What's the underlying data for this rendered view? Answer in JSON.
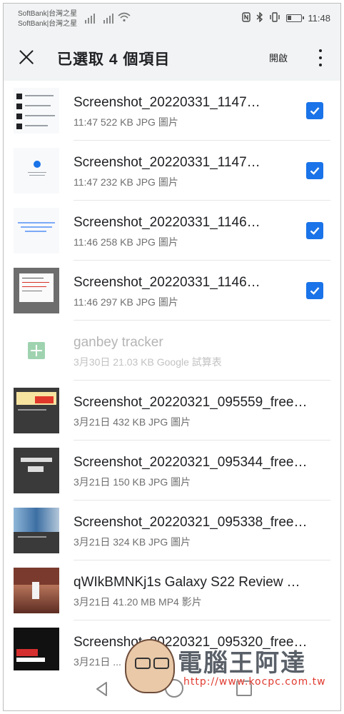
{
  "status_bar": {
    "carrier_1": "SoftBank|台灣之星",
    "carrier_2": "SoftBank|台灣之星",
    "time": "11:48",
    "icons": [
      "signal-icon",
      "wifi-icon",
      "nfc-icon",
      "bluetooth-icon",
      "vibrate-icon",
      "battery-icon"
    ]
  },
  "app_bar": {
    "title": "已選取 4 個項目",
    "open_label": "開啟",
    "icons": [
      "close-icon",
      "more-vert-icon"
    ]
  },
  "files": [
    {
      "name": "Screenshot_20220331_1147…",
      "meta": "11:47 522 KB JPG 圖片",
      "selected": true,
      "thumb": "screenshot-list"
    },
    {
      "name": "Screenshot_20220331_1147…",
      "meta": "11:47 232 KB JPG 圖片",
      "selected": true,
      "thumb": "screenshot-light"
    },
    {
      "name": "Screenshot_20220331_1146…",
      "meta": "11:46 258 KB JPG 圖片",
      "selected": true,
      "thumb": "screenshot-light"
    },
    {
      "name": "Screenshot_20220331_1146…",
      "meta": "11:46 297 KB JPG 圖片",
      "selected": true,
      "thumb": "screenshot-dialog"
    },
    {
      "name": "ganbey tracker",
      "meta": "3月30日 21.03 KB Google 試算表",
      "selected": false,
      "disabled": true,
      "thumb": "sheets-icon"
    },
    {
      "name": "Screenshot_20220321_095559_free.…",
      "meta": "3月21日 432 KB JPG 圖片",
      "selected": false,
      "thumb": "screenshot-dark"
    },
    {
      "name": "Screenshot_20220321_095344_free.…",
      "meta": "3月21日 150 KB JPG 圖片",
      "selected": false,
      "thumb": "screenshot-dark"
    },
    {
      "name": "Screenshot_20220321_095338_free.…",
      "meta": "3月21日 324 KB JPG 圖片",
      "selected": false,
      "thumb": "screenshot-phones"
    },
    {
      "name": "qWIkBMNKj1s Galaxy S22 Review T…",
      "meta": "3月21日 41.20 MB MP4 影片",
      "selected": false,
      "thumb": "video-basketball"
    },
    {
      "name": "Screenshot_20220321_095320_free.…",
      "meta": "3月21日 ...",
      "selected": false,
      "thumb": "screenshot-dark"
    }
  ],
  "nav_bar": {
    "icons": [
      "back-icon",
      "home-icon",
      "recent-apps-icon"
    ]
  },
  "watermark": {
    "title": "電腦王阿達",
    "url": "http://www.kocpc.com.tw"
  },
  "colors": {
    "accent": "#1a73e8",
    "app_bar_bg": "#f1f3f4",
    "text_primary": "#202124",
    "text_secondary": "#6f6f6f"
  }
}
